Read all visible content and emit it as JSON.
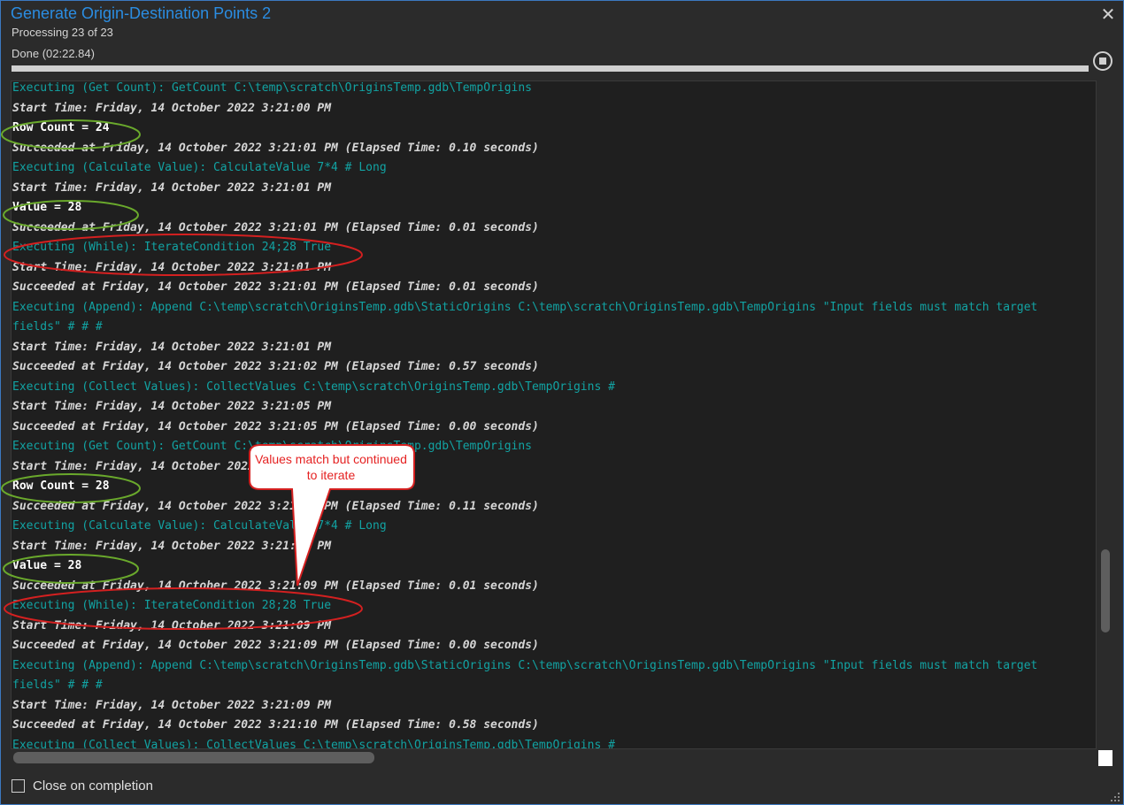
{
  "window": {
    "title": "Generate Origin-Destination Points 2",
    "processing": "Processing 23 of 23",
    "status": "Done (02:22.84)",
    "progress_percent": 100,
    "close_glyph": "✕",
    "close_icon": "close-icon",
    "stop_icon": "stop-icon"
  },
  "log": {
    "lines": [
      {
        "type": "exec",
        "text": "Executing (Get Count): GetCount C:\\temp\\scratch\\OriginsTemp.gdb\\TempOrigins"
      },
      {
        "type": "info",
        "text": "Start Time: Friday, 14 October 2022 3:21:00 PM"
      },
      {
        "type": "result",
        "text": "Row Count = 24"
      },
      {
        "type": "info",
        "text": "Succeeded at Friday, 14 October 2022 3:21:01 PM (Elapsed Time: 0.10 seconds)"
      },
      {
        "type": "exec",
        "text": "Executing (Calculate Value): CalculateValue 7*4 # Long"
      },
      {
        "type": "info",
        "text": "Start Time: Friday, 14 October 2022 3:21:01 PM"
      },
      {
        "type": "result",
        "text": "Value = 28"
      },
      {
        "type": "info",
        "text": "Succeeded at Friday, 14 October 2022 3:21:01 PM (Elapsed Time: 0.01 seconds)"
      },
      {
        "type": "exec",
        "text": "Executing (While): IterateCondition 24;28 True"
      },
      {
        "type": "info",
        "text": "Start Time: Friday, 14 October 2022 3:21:01 PM"
      },
      {
        "type": "info",
        "text": "Succeeded at Friday, 14 October 2022 3:21:01 PM (Elapsed Time: 0.01 seconds)"
      },
      {
        "type": "exec",
        "text": "Executing (Append): Append C:\\temp\\scratch\\OriginsTemp.gdb\\StaticOrigins C:\\temp\\scratch\\OriginsTemp.gdb\\TempOrigins \"Input fields must match target"
      },
      {
        "type": "exec",
        "text": "fields\" # # #"
      },
      {
        "type": "info",
        "text": "Start Time: Friday, 14 October 2022 3:21:01 PM"
      },
      {
        "type": "info",
        "text": "Succeeded at Friday, 14 October 2022 3:21:02 PM (Elapsed Time: 0.57 seconds)"
      },
      {
        "type": "exec",
        "text": "Executing (Collect Values): CollectValues C:\\temp\\scratch\\OriginsTemp.gdb\\TempOrigins #"
      },
      {
        "type": "info",
        "text": "Start Time: Friday, 14 October 2022 3:21:05 PM"
      },
      {
        "type": "info",
        "text": "Succeeded at Friday, 14 October 2022 3:21:05 PM (Elapsed Time: 0.00 seconds)"
      },
      {
        "type": "exec",
        "text": "Executing (Get Count): GetCount C:\\temp\\scratch\\OriginsTemp.gdb\\TempOrigins"
      },
      {
        "type": "info",
        "text": "Start Time: Friday, 14 October 2022 3:21:05 PM"
      },
      {
        "type": "result",
        "text": "Row Count = 28"
      },
      {
        "type": "info",
        "text": "Succeeded at Friday, 14 October 2022 3:21:09 PM (Elapsed Time: 0.11 seconds)"
      },
      {
        "type": "exec",
        "text": "Executing (Calculate Value): CalculateValue 7*4 # Long"
      },
      {
        "type": "info",
        "text": "Start Time: Friday, 14 October 2022 3:21:09 PM"
      },
      {
        "type": "result",
        "text": "Value = 28"
      },
      {
        "type": "info",
        "text": "Succeeded at Friday, 14 October 2022 3:21:09 PM (Elapsed Time: 0.01 seconds)"
      },
      {
        "type": "exec",
        "text": "Executing (While): IterateCondition 28;28 True"
      },
      {
        "type": "info",
        "text": "Start Time: Friday, 14 October 2022 3:21:09 PM"
      },
      {
        "type": "info",
        "text": "Succeeded at Friday, 14 October 2022 3:21:09 PM (Elapsed Time: 0.00 seconds)"
      },
      {
        "type": "exec",
        "text": "Executing (Append): Append C:\\temp\\scratch\\OriginsTemp.gdb\\StaticOrigins C:\\temp\\scratch\\OriginsTemp.gdb\\TempOrigins \"Input fields must match target"
      },
      {
        "type": "exec",
        "text": "fields\" # # #"
      },
      {
        "type": "info",
        "text": "Start Time: Friday, 14 October 2022 3:21:09 PM"
      },
      {
        "type": "info",
        "text": "Succeeded at Friday, 14 October 2022 3:21:10 PM (Elapsed Time: 0.58 seconds)"
      },
      {
        "type": "exec",
        "text": "Executing (Collect Values): CollectValues C:\\temp\\scratch\\OriginsTemp.gdb\\TempOrigins #"
      }
    ]
  },
  "annotation": {
    "callout_text": "Values match but continued to iterate",
    "green_color": "#6aa92c",
    "red_color": "#d42020"
  },
  "footer": {
    "close_on_completion_label": "Close on completion",
    "close_on_completion_checked": false
  },
  "colors": {
    "title": "#2b8de2",
    "exec_line": "#12a3a3",
    "info_line": "#d6d6d6",
    "result_line": "#ffffff",
    "background": "#2b2b2b",
    "log_background": "#1f1f1f"
  }
}
